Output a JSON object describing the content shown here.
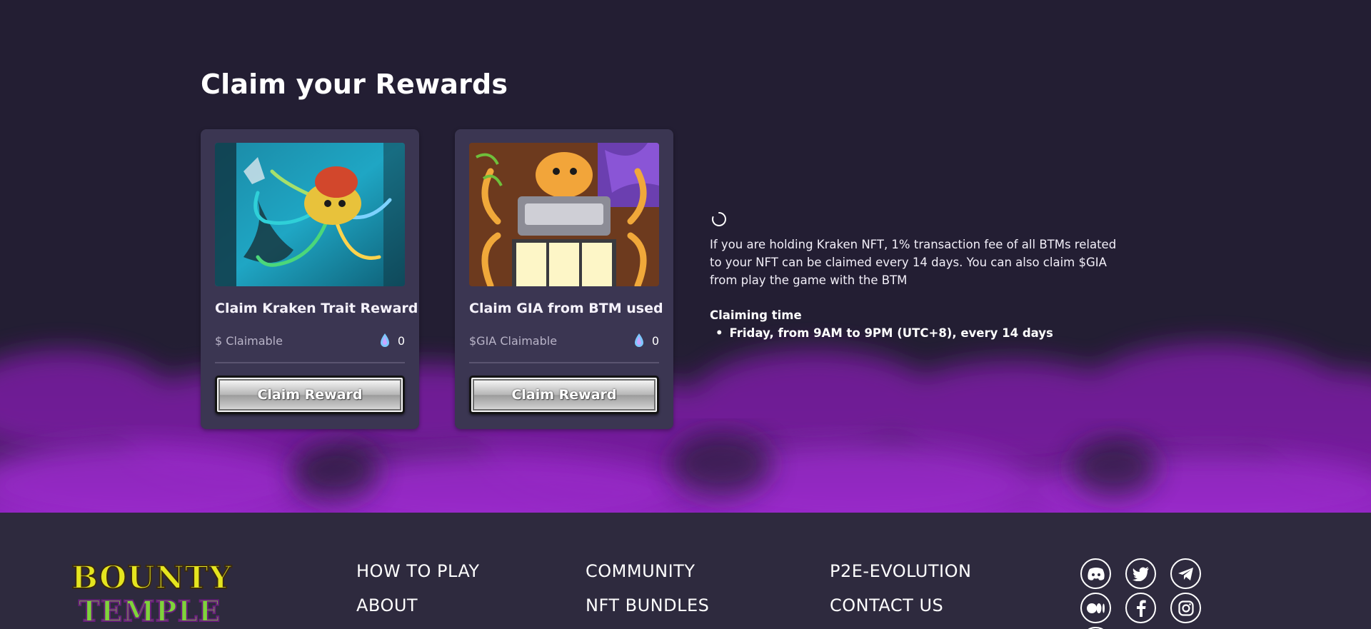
{
  "page": {
    "title": "Claim your Rewards"
  },
  "cards": [
    {
      "title": "Claim Kraken Trait Reward",
      "claimable_label": "$ Claimable",
      "amount": "0",
      "button": "Claim Reward",
      "image": "kraken-artwork"
    },
    {
      "title": "Claim GIA from BTM used",
      "claimable_label": "$GIA Claimable",
      "amount": "0",
      "button": "Claim Reward",
      "image": "kraken-slot-machine-artwork"
    }
  ],
  "info": {
    "description": "If you are holding Kraken NFT, 1% transaction fee of all BTMs related to your NFT can be claimed every 14 days. You can also claim $GIA from play the game with the BTM",
    "claiming_title": "Claiming time",
    "claiming_items": [
      "Friday, from 9AM to 9PM (UTC+8), every 14 days"
    ]
  },
  "footer": {
    "logo_line1": "BOUNTY",
    "logo_line2": "TEMPLE",
    "nav": {
      "how_to_play": "HOW TO PLAY",
      "about": "ABOUT",
      "community": "COMMUNITY",
      "nft_bundles": "NFT BUNDLES",
      "p2e": "P2E-EVOLUTION",
      "contact": "CONTACT US"
    },
    "social_icons": [
      "discord-icon",
      "twitter-icon",
      "telegram-icon",
      "medium-icon",
      "facebook-icon",
      "instagram-icon"
    ]
  },
  "colors": {
    "background": "#231e33",
    "card": "#3b3652",
    "smoke": "#8a22b8",
    "footer": "#2e2a3e"
  }
}
